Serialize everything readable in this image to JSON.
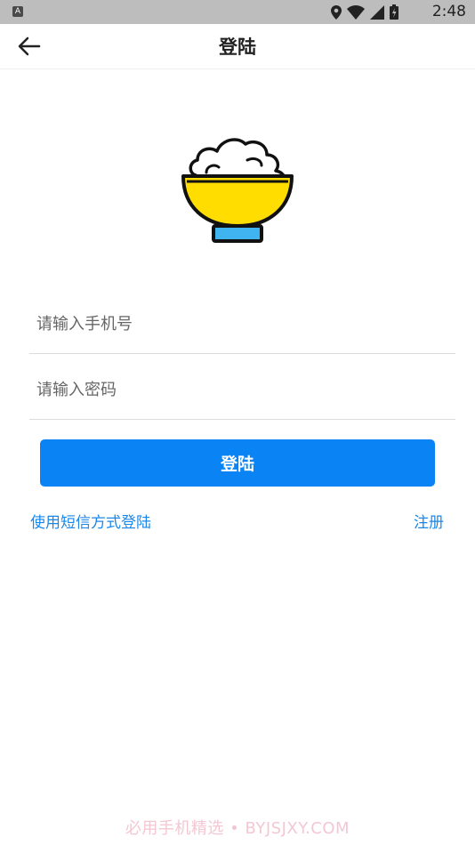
{
  "status_bar": {
    "app_indicator": "A",
    "time": "2:48",
    "icons": [
      "location-icon",
      "wifi-icon",
      "signal-icon",
      "battery-icon"
    ]
  },
  "toolbar": {
    "title": "登陆",
    "back_icon": "back-arrow-icon"
  },
  "logo": {
    "icon": "rice-bowl-icon",
    "colors": {
      "rice": "#ffffff",
      "bowl": "#ffdd00",
      "base": "#3fb4f0",
      "outline": "#111111"
    }
  },
  "form": {
    "phone": {
      "placeholder": "请输入手机号",
      "value": ""
    },
    "password": {
      "placeholder": "请输入密码",
      "value": ""
    },
    "login_label": "登陆"
  },
  "links": {
    "sms_login": "使用短信方式登陆",
    "register": "注册"
  },
  "watermark": "必用手机精选 • BYJSJXY.COM",
  "colors": {
    "accent": "#0a84f5",
    "link": "#1a87e8",
    "status_bar": "#bdbdbd"
  }
}
